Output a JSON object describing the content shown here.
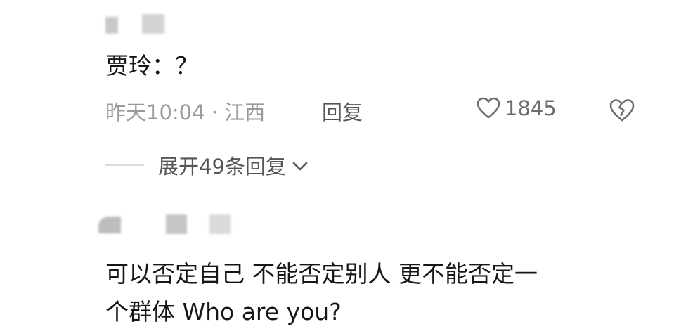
{
  "comments": [
    {
      "text": "贾玲：？",
      "meta": {
        "time_location": "昨天10:04 · 江西",
        "reply_label": "回复",
        "like_count": "1845"
      },
      "expand_label": "展开49条回复"
    },
    {
      "text_line1": "可以否定自己 不能否定别人 更不能否定一",
      "text_line2": "个群体 Who are you?"
    }
  ],
  "icons": {
    "like": "heart-outline-icon",
    "dislike": "broken-heart-icon",
    "expand": "chevron-down-icon"
  },
  "colors": {
    "text_primary": "#161616",
    "text_meta": "#9a9a9a",
    "text_action": "#555555"
  }
}
